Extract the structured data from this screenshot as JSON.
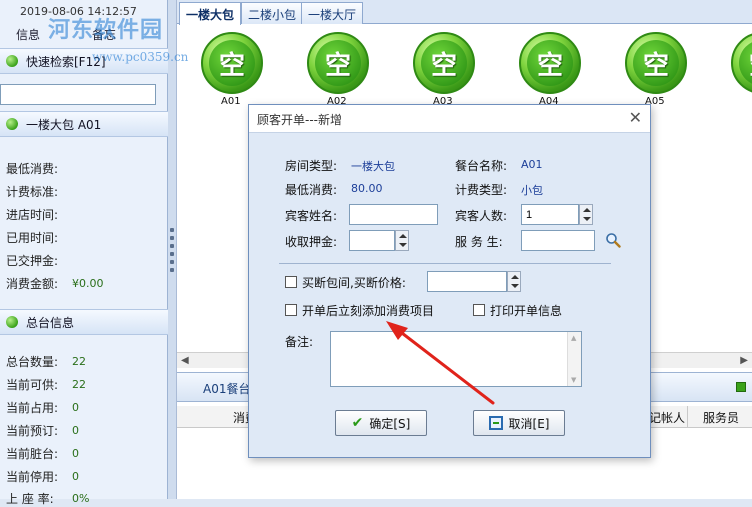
{
  "left_panel": {
    "datetime": "2019-08-06 14:12:57",
    "tabs": [
      "信息",
      "备忘"
    ],
    "watermark_logo": "河东软件园",
    "watermark_url": "www.pc0359.cn",
    "quick_search_label": "快速检索[F12]",
    "search_value": "",
    "room_header": "一楼大包  A01",
    "room_info": [
      {
        "label": "最低消费:",
        "value": ""
      },
      {
        "label": "计费标准:",
        "value": ""
      },
      {
        "label": "进店时间:",
        "value": ""
      },
      {
        "label": "已用时间:",
        "value": ""
      },
      {
        "label": "已交押金:",
        "value": ""
      },
      {
        "label": "消费金额:",
        "value": "¥0.00"
      }
    ],
    "summary_header": "总台信息",
    "summary": [
      {
        "label": "总台数量:",
        "value": "22"
      },
      {
        "label": "当前可供:",
        "value": "22"
      },
      {
        "label": "当前占用:",
        "value": "0"
      },
      {
        "label": "当前预订:",
        "value": "0"
      },
      {
        "label": "当前脏台:",
        "value": "0"
      },
      {
        "label": "当前停用:",
        "value": "0"
      },
      {
        "label": "上 座 率:",
        "value": "0%"
      }
    ]
  },
  "main": {
    "tabs": [
      "一楼大包",
      "二楼小包",
      "一楼大厅"
    ],
    "active_tab": "一楼大包",
    "rooms": [
      {
        "status": "空",
        "code": "A01"
      },
      {
        "status": "空",
        "code": "A02"
      },
      {
        "status": "空",
        "code": "A03"
      },
      {
        "status": "空",
        "code": "A04"
      },
      {
        "status": "空",
        "code": "A05"
      },
      {
        "status": "空",
        "code": ""
      }
    ],
    "bottom_tab": "A01餐台",
    "grid_columns": [
      "消费",
      "记帐人",
      "服务员"
    ]
  },
  "dialog": {
    "title": "顾客开单---新增",
    "room_type_label": "房间类型:",
    "room_type_value": "一楼大包",
    "table_name_label": "餐台名称:",
    "table_name_value": "A01",
    "min_consume_label": "最低消费:",
    "min_consume_value": "80.00",
    "billing_type_label": "计费类型:",
    "billing_type_value": "小包",
    "guest_name_label": "宾客姓名:",
    "guest_name_value": "",
    "guest_count_label": "宾客人数:",
    "guest_count_value": "1",
    "deposit_label": "收取押金:",
    "deposit_value": "",
    "waiter_label": "服 务 生:",
    "waiter_value": "",
    "buyout_label": "买断包间,买断价格:",
    "buyout_value": "",
    "add_items_label": "开单后立刻添加消费项目",
    "print_label": "打印开单信息",
    "remark_label": "备注:",
    "remark_value": "",
    "ok_label": "确定[S]",
    "cancel_label": "取消[E]"
  },
  "colors": {
    "accent_blue": "#1d3f99",
    "status_green": "#3aa21a",
    "annotation_red": "#e0231b"
  }
}
